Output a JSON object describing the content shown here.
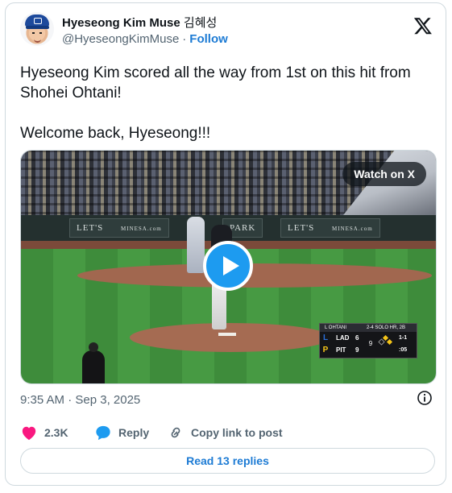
{
  "author": {
    "display_name": "Hyeseong Kim Muse",
    "display_name_korean": "김혜성",
    "handle": "@HyeseongKimMuse",
    "separator": "·",
    "follow_label": "Follow",
    "avatar_icon": "avatar-photo"
  },
  "brand_icon": "x-logo-icon",
  "tweet": {
    "line1": "Hyeseong Kim scored all the way from 1st on this hit from Shohei Ohtani!",
    "line2": "Welcome back, Hyeseong!!!"
  },
  "media": {
    "watch_label": "Watch on X",
    "play_icon": "play-icon",
    "ad_left": "LET'S",
    "ad_left_suffix": "MINESA.com",
    "ad_mid": "PARK",
    "ad_right": "LET'S",
    "ad_right_suffix": "MINESA.com",
    "scorebug": {
      "batter": "L OHTANI",
      "event": "2-4 SOLO HR, 2B",
      "team1": "LAD",
      "score1": "6",
      "team2": "PIT",
      "score2": "9",
      "inning": "9",
      "count": "1-1",
      "clock": ":05"
    }
  },
  "meta": {
    "timestamp": "9:35 AM · Sep 3, 2025",
    "info_icon": "info-icon"
  },
  "actions": {
    "likes": "2.3K",
    "reply_label": "Reply",
    "copy_label": "Copy link to post"
  },
  "read_replies_label": "Read 13 replies",
  "colors": {
    "accent": "#1d9bf0",
    "link": "#1d7bd4",
    "like": "#f91880",
    "secondary_text": "#536471",
    "border": "#cfd9de"
  }
}
